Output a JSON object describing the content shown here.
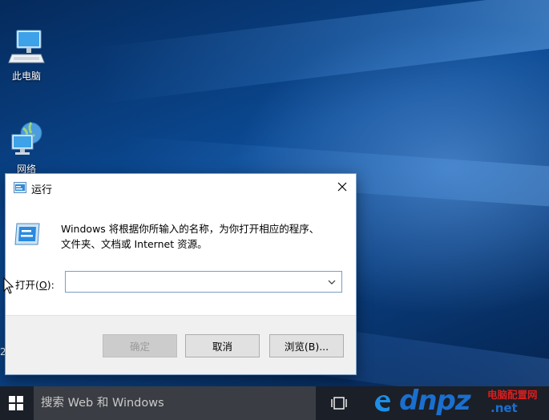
{
  "desktop": {
    "icons": [
      {
        "label": "此电脑",
        "icon": "computer-icon"
      },
      {
        "label": "网络",
        "icon": "network-icon"
      }
    ],
    "edge_digit": "2"
  },
  "run_dialog": {
    "title": "运行",
    "description_line1": "Windows 将根据你所输入的名称，为你打开相应的程序、",
    "description_line2": "文件夹、文档或 Internet 资源。",
    "open_label_prefix": "打开(",
    "open_label_key": "O",
    "open_label_suffix": "):",
    "input_value": "",
    "buttons": {
      "ok": "确定",
      "cancel": "取消",
      "browse": "浏览(B)..."
    }
  },
  "taskbar": {
    "search_placeholder": "搜索 Web 和 Windows",
    "watermark_brand": "dnpz",
    "watermark_cn": "电脑配置网",
    "watermark_domain": ".net"
  },
  "colors": {
    "accent_blue": "#0b4a94",
    "border": "#7a9ec4",
    "taskbar": "#1b1f27"
  }
}
